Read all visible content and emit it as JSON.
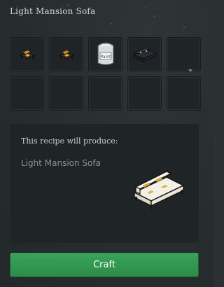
{
  "window": {
    "title": "Light Mansion Sofa"
  },
  "ingredients": {
    "slots": [
      {
        "item": "small-dark-chair-icon"
      },
      {
        "item": "small-dark-chair-icon"
      },
      {
        "item": "paint-can-icon",
        "label": "Paint"
      },
      {
        "item": "dark-sofa-icon"
      },
      {
        "item": ""
      },
      {
        "item": ""
      },
      {
        "item": ""
      },
      {
        "item": ""
      },
      {
        "item": ""
      },
      {
        "item": ""
      }
    ]
  },
  "result": {
    "produce_label": "This recipe will produce:",
    "name": "Light Mansion Sofa",
    "icon": "light-sofa-icon"
  },
  "actions": {
    "craft_label": "Craft"
  },
  "colors": {
    "craft_button": "#2f9a4f",
    "background": "#2b3032",
    "slot": "#1f2426"
  }
}
